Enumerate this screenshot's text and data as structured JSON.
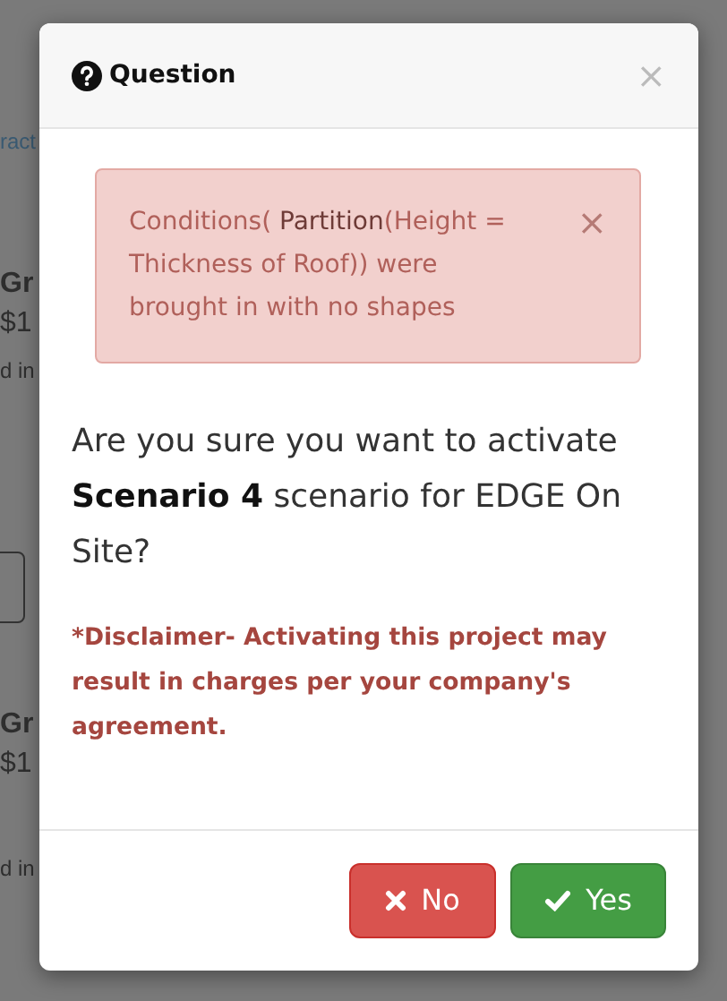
{
  "background": {
    "items": [
      {
        "kind": "link",
        "text": "ract"
      },
      {
        "kind": "title",
        "text": "Gr"
      },
      {
        "kind": "price",
        "text": "$1"
      },
      {
        "kind": "note",
        "text": "d in"
      },
      {
        "kind": "button"
      },
      {
        "kind": "title",
        "text": "Gr"
      },
      {
        "kind": "price",
        "text": "$1"
      },
      {
        "kind": "note",
        "text": "d in"
      }
    ]
  },
  "modal": {
    "title": "Question",
    "close": "×",
    "alert": {
      "close": "×",
      "text": "Conditions( **Partition**(Height = Thickness of Roof)) were brought in with no shapes"
    },
    "message": "Are you sure you want to activate **Scenario 4** scenario for EDGE On Site?",
    "disclaimer": "*Disclaimer- Activating this project may result in charges per your company's agreement.",
    "buttons": [
      {
        "kind": "no",
        "label": "No"
      },
      {
        "kind": "yes",
        "label": "Yes"
      }
    ]
  }
}
